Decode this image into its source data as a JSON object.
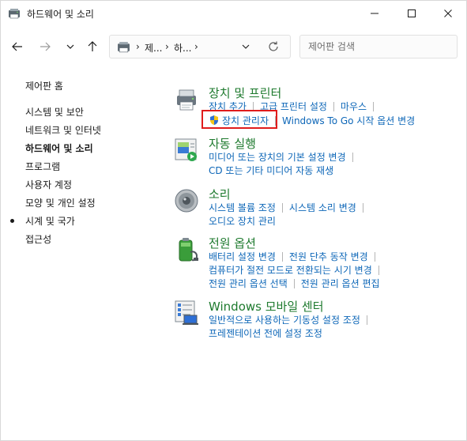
{
  "window": {
    "title": "하드웨어 및 소리",
    "controls": {
      "minimize": "—",
      "maximize": "☐",
      "close": "✕"
    }
  },
  "navigation": {
    "breadcrumbs": [
      "제...",
      "하..."
    ],
    "breadcrumb_separator": "›",
    "search_placeholder": "제어판 검색"
  },
  "sidebar": {
    "items": [
      {
        "label": "제어판 홈",
        "active": false
      },
      {
        "label": "시스템 및 보안",
        "active": false
      },
      {
        "label": "네트워크 및 인터넷",
        "active": false
      },
      {
        "label": "하드웨어 및 소리",
        "active": true
      },
      {
        "label": "프로그램",
        "active": false
      },
      {
        "label": "사용자 계정",
        "active": false
      },
      {
        "label": "모양 및 개인 설정",
        "active": false
      },
      {
        "label": "시계 및 국가",
        "active": false
      },
      {
        "label": "접근성",
        "active": false
      }
    ]
  },
  "categories": [
    {
      "title": "장치 및 프린터",
      "icon": "printer-icon",
      "links": [
        [
          "장치 추가",
          "고급 프린터 설정",
          "마우스"
        ],
        [
          "장치 관리자",
          "Windows To Go 시작 옵션 변경"
        ]
      ]
    },
    {
      "title": "자동 실행",
      "icon": "autoplay-icon",
      "links": [
        [
          "미디어 또는 장치의 기본 설정 변경"
        ],
        [
          "CD 또는 기타 미디어 자동 재생"
        ]
      ]
    },
    {
      "title": "소리",
      "icon": "speaker-icon",
      "links": [
        [
          "시스템 볼륨 조정",
          "시스템 소리 변경"
        ],
        [
          "오디오 장치 관리"
        ]
      ]
    },
    {
      "title": "전원 옵션",
      "icon": "battery-icon",
      "links": [
        [
          "배터리 설정 변경",
          "전원 단추 동작 변경"
        ],
        [
          "컴퓨터가 절전 모드로 전환되는 시기 변경"
        ],
        [
          "전원 관리 옵션 선택",
          "전원 관리 옵션 편집"
        ]
      ]
    },
    {
      "title": "Windows 모바일 센터",
      "icon": "mobility-center-icon",
      "links": [
        [
          "일반적으로 사용하는 기동성 설정 조정"
        ],
        [
          "프레젠테이션 전에 설정 조정"
        ]
      ]
    }
  ],
  "colors": {
    "category_title": "#1e7a2e",
    "link": "#0e67b8",
    "highlight": "#e01c1c"
  }
}
